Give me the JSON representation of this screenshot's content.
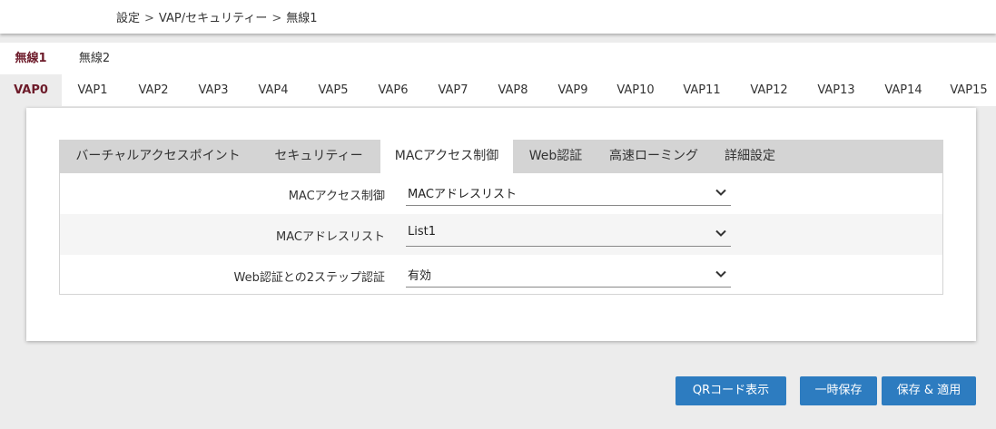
{
  "breadcrumb": [
    "設定",
    "VAP/セキュリティー",
    "無線1"
  ],
  "breadcrumb_separator": ">",
  "radio_tabs": [
    {
      "label": "無線1",
      "active": true
    },
    {
      "label": "無線2",
      "active": false
    }
  ],
  "vap_tabs": [
    {
      "label": "VAP0",
      "active": true
    },
    {
      "label": "VAP1"
    },
    {
      "label": "VAP2"
    },
    {
      "label": "VAP3"
    },
    {
      "label": "VAP4"
    },
    {
      "label": "VAP5"
    },
    {
      "label": "VAP6"
    },
    {
      "label": "VAP7"
    },
    {
      "label": "VAP8"
    },
    {
      "label": "VAP9"
    },
    {
      "label": "VAP10"
    },
    {
      "label": "VAP11"
    },
    {
      "label": "VAP12"
    },
    {
      "label": "VAP13"
    },
    {
      "label": "VAP14"
    },
    {
      "label": "VAP15"
    }
  ],
  "sub_tabs": [
    {
      "label": "バーチャルアクセスポイント"
    },
    {
      "label": "セキュリティー"
    },
    {
      "label": "MACアクセス制御",
      "active": true
    },
    {
      "label": "Web認証"
    },
    {
      "label": "高速ローミング"
    },
    {
      "label": "詳細設定"
    }
  ],
  "form": {
    "mac_access_control": {
      "label": "MACアクセス制御",
      "value": "MACアドレスリスト"
    },
    "mac_address_list": {
      "label": "MACアドレスリスト",
      "value": "List1"
    },
    "web_auth_two_step": {
      "label": "Web認証との2ステップ認証",
      "value": "有効"
    }
  },
  "buttons": {
    "qr": "QRコード表示",
    "temp_save": "一時保存",
    "save_apply": "保存 & 適用"
  },
  "colors": {
    "accent": "#2d7cc0",
    "active_tab_text": "#6d1b2a",
    "background": "#ececec",
    "subtab_bar": "#d4d4d4"
  }
}
